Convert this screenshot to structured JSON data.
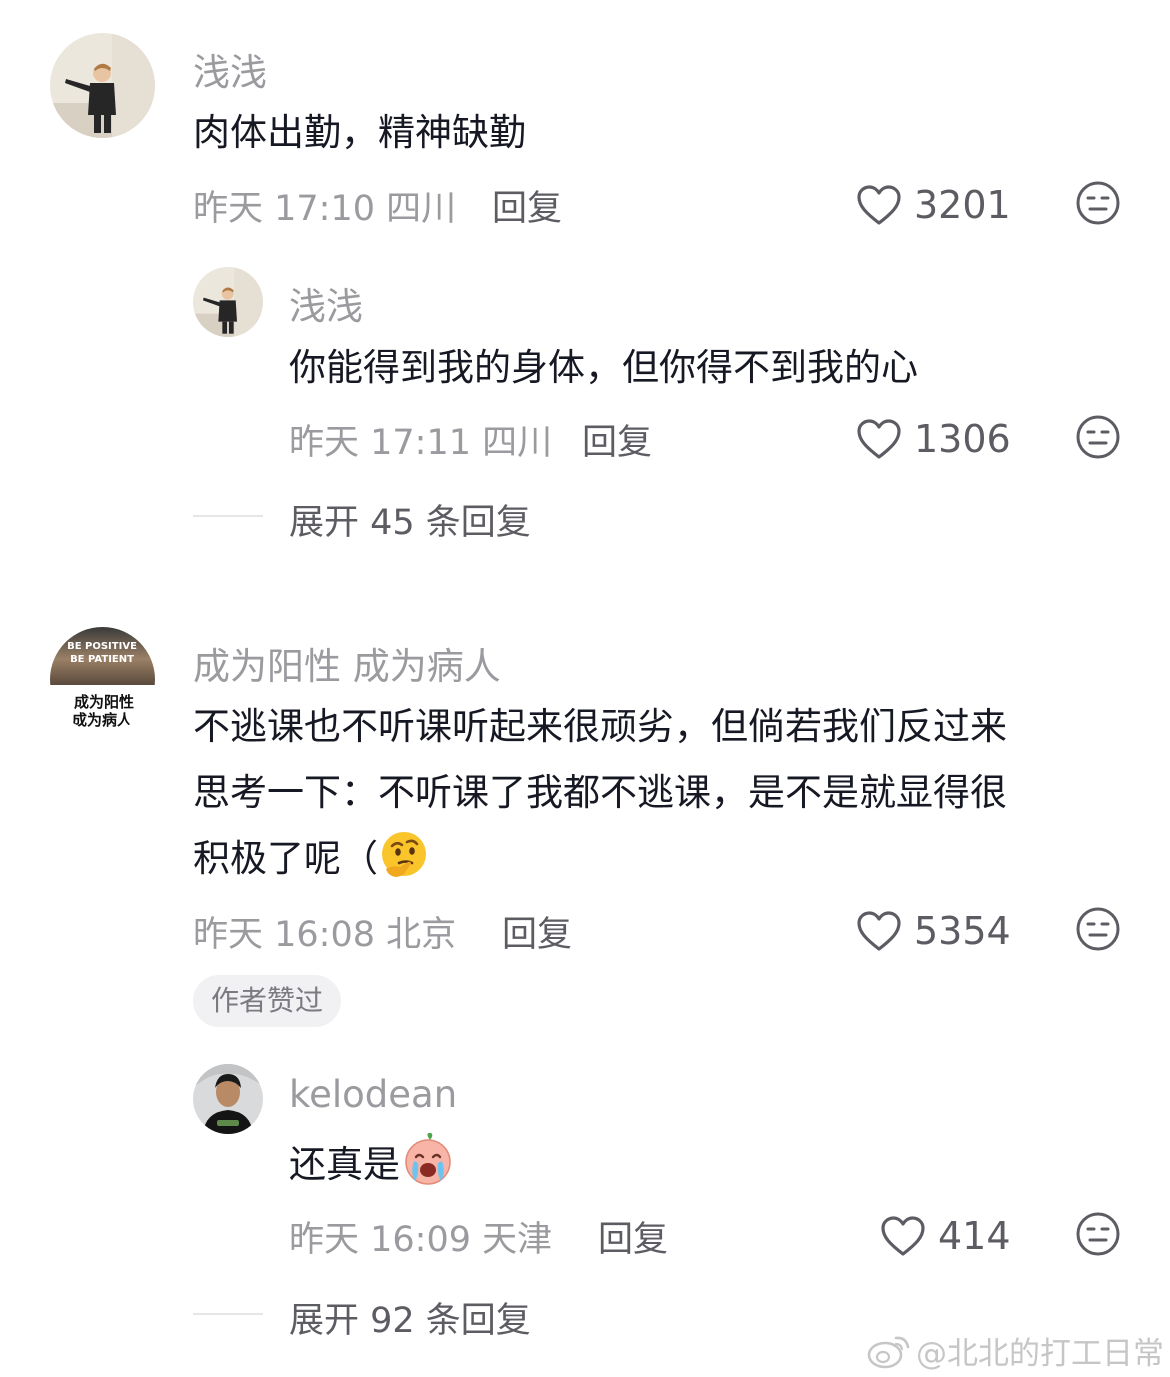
{
  "comments": [
    {
      "username": "浅浅",
      "text": "肉体出勤，精神缺勤",
      "meta": "昨天 17:10 四川",
      "reply_label": "回复",
      "likes": "3201",
      "replies": [
        {
          "username": "浅浅",
          "text": "你能得到我的身体，但你得不到我的心",
          "meta": "昨天 17:11 四川",
          "reply_label": "回复",
          "likes": "1306"
        }
      ],
      "expand_label": "展开 45 条回复"
    },
    {
      "username": "成为阳性 成为病人",
      "avatar_text": [
        "BE POSITIVE",
        "BE PATIENT",
        "成为阳性",
        "成为病人"
      ],
      "text_lines": [
        "不逃课也不听课听起来很顽劣，但倘若我们反过来",
        "思考一下：不听课了我都不逃课，是不是就显得很",
        "积极了呢（"
      ],
      "meta": "昨天 16:08 北京",
      "reply_label": "回复",
      "likes": "5354",
      "author_badge": "作者赞过",
      "replies": [
        {
          "username": "kelodean",
          "text": "还真是",
          "meta": "昨天 16:09 天津",
          "reply_label": "回复",
          "likes": "414"
        }
      ],
      "expand_label": "展开 92 条回复"
    }
  ],
  "watermark": "@北北的打工日常",
  "colors": {
    "primary_text": "#161823",
    "secondary_text": "#9a9a9f",
    "action_text": "#5c5c63"
  }
}
